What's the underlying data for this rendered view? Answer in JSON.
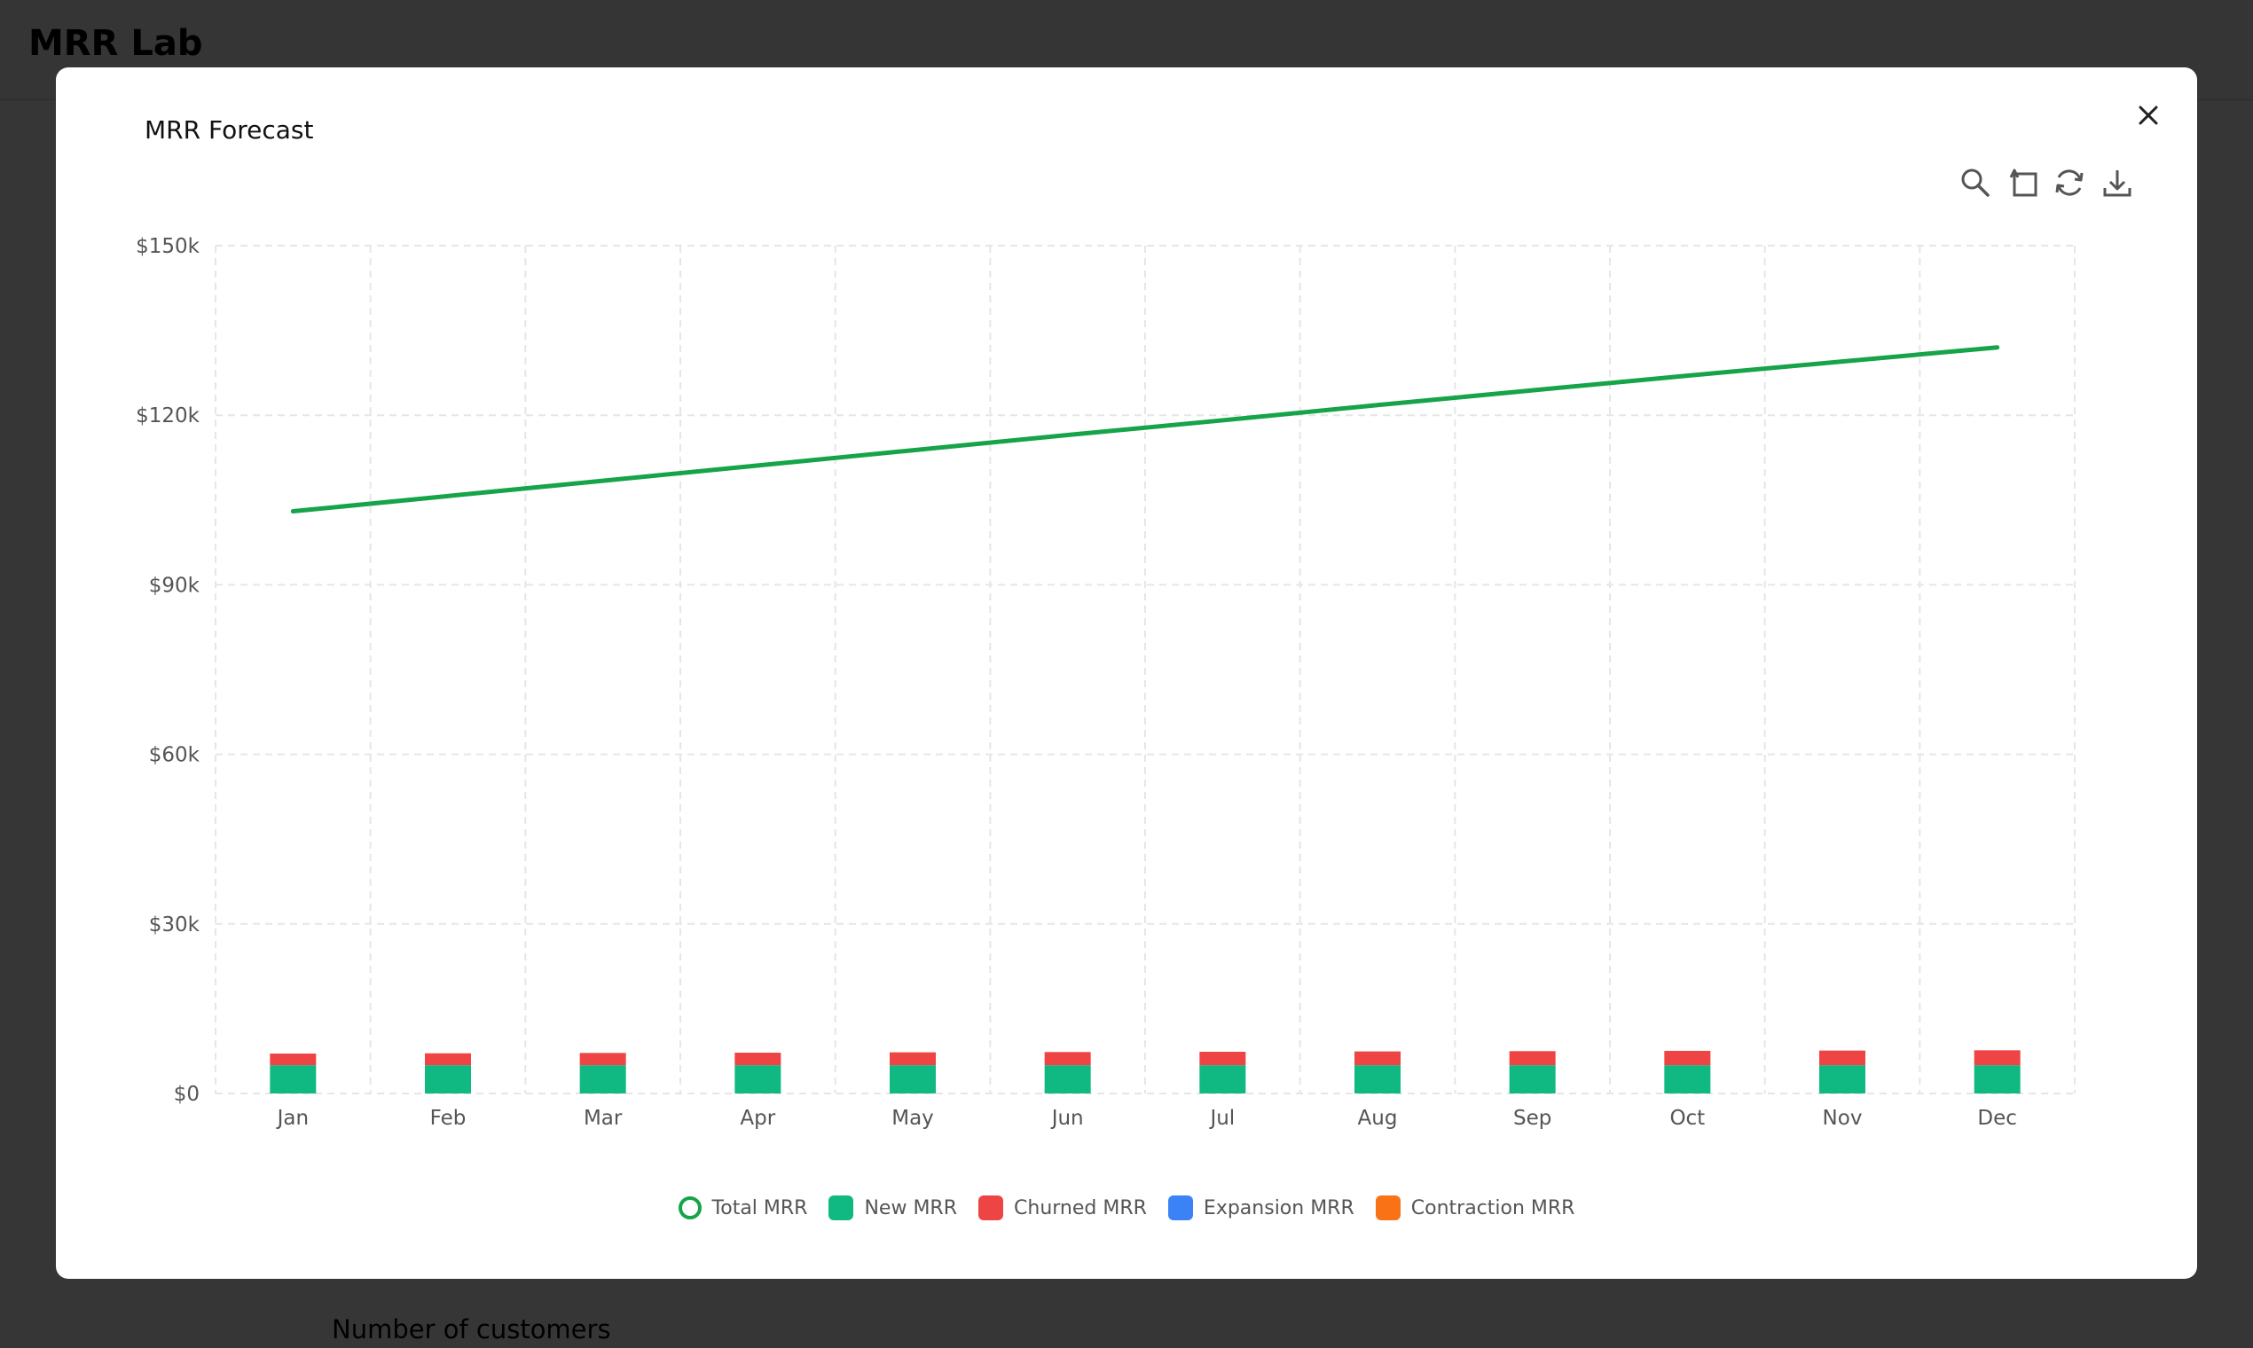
{
  "app": {
    "title": "MRR Lab"
  },
  "background": {
    "section_label": "Number of customers"
  },
  "modal": {
    "title": "MRR Forecast",
    "toolbar": [
      {
        "name": "zoom-icon"
      },
      {
        "name": "reset-zoom-icon"
      },
      {
        "name": "restore-icon"
      },
      {
        "name": "download-icon"
      }
    ],
    "close_icon": "close-icon"
  },
  "colors": {
    "total_mrr": "#16a34a",
    "new_mrr": "#10b981",
    "churned_mrr": "#ef4444",
    "expansion_mrr": "#3b82f6",
    "contraction_mrr": "#f97316",
    "grid": "#e6e6e6"
  },
  "chart_data": {
    "type": "bar",
    "categories": [
      "Jan",
      "Feb",
      "Mar",
      "Apr",
      "May",
      "Jun",
      "Jul",
      "Aug",
      "Sep",
      "Oct",
      "Nov",
      "Dec"
    ],
    "ylim": [
      0,
      150000
    ],
    "yticks": [
      0,
      30000,
      60000,
      90000,
      120000,
      150000
    ],
    "ytick_labels": [
      "$0",
      "$30k",
      "$60k",
      "$90k",
      "$120k",
      "$150k"
    ],
    "grid": true,
    "legend_position": "bottom",
    "stacked": true,
    "series": [
      {
        "name": "Total MRR",
        "type": "line",
        "color": "#16a34a",
        "values": [
          103000,
          105700,
          108400,
          111100,
          113800,
          116500,
          119100,
          121800,
          124400,
          127000,
          129500,
          132000
        ]
      },
      {
        "name": "New MRR",
        "type": "bar",
        "color": "#10b981",
        "values": [
          5000,
          5000,
          5000,
          5000,
          5000,
          5000,
          5000,
          5000,
          5000,
          5000,
          5000,
          5000
        ]
      },
      {
        "name": "Churned MRR",
        "type": "bar",
        "color": "#ef4444",
        "values": [
          2060,
          2110,
          2170,
          2220,
          2280,
          2330,
          2380,
          2440,
          2490,
          2540,
          2590,
          2640
        ]
      },
      {
        "name": "Expansion MRR",
        "type": "bar",
        "color": "#3b82f6",
        "values": [
          0,
          0,
          0,
          0,
          0,
          0,
          0,
          0,
          0,
          0,
          0,
          0
        ]
      },
      {
        "name": "Contraction MRR",
        "type": "bar",
        "color": "#f97316",
        "values": [
          0,
          0,
          0,
          0,
          0,
          0,
          0,
          0,
          0,
          0,
          0,
          0
        ]
      }
    ]
  }
}
